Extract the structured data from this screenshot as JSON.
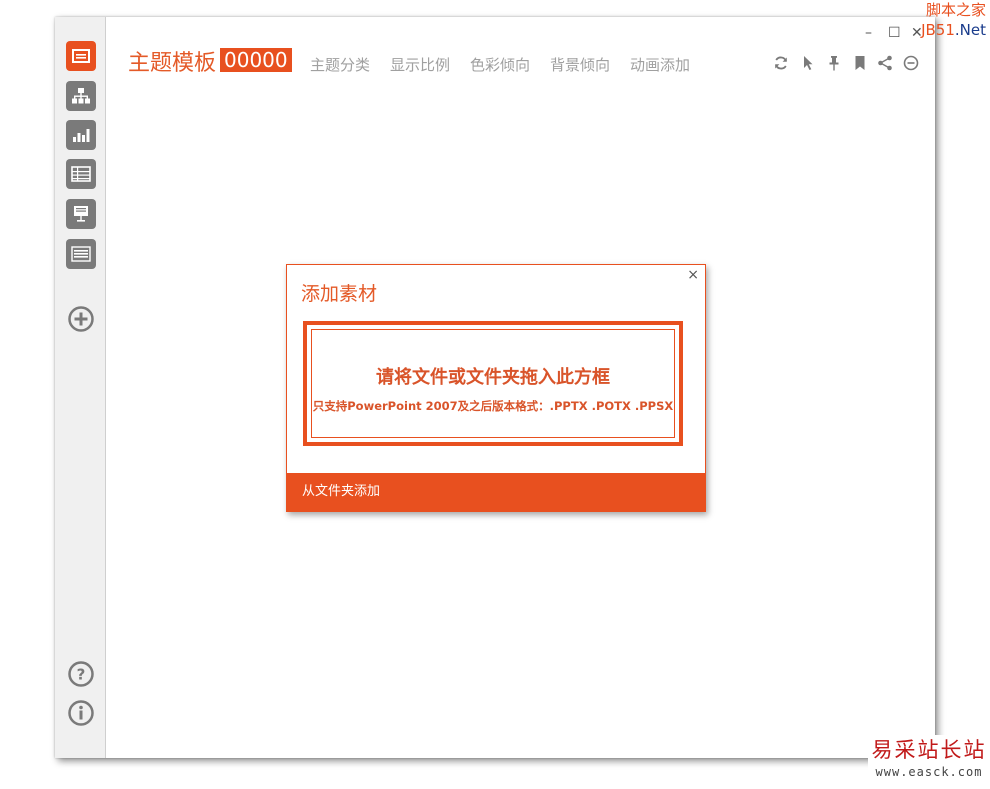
{
  "window": {
    "title": "主题模板",
    "code": "00000",
    "controls": {
      "minimize": "–",
      "maximize": "☐",
      "close": "✕"
    }
  },
  "menu": [
    {
      "label": "主题分类"
    },
    {
      "label": "显示比例"
    },
    {
      "label": "色彩倾向"
    },
    {
      "label": "背景倾向"
    },
    {
      "label": "动画添加"
    }
  ],
  "toolbar_icons": [
    "refresh-icon",
    "cursor-icon",
    "pin-icon",
    "bookmark-icon",
    "share-icon",
    "minus-circle-icon"
  ],
  "sidebar_icons": [
    "template-icon",
    "org-chart-icon",
    "bar-chart-icon",
    "table-icon",
    "presentation-icon",
    "keyboard-icon",
    "add-circle-icon",
    "help-icon",
    "info-icon"
  ],
  "dialog": {
    "title": "添加素材",
    "close": "×",
    "drop_main": "请将文件或文件夹拖入此方框",
    "drop_sub": "只支持PowerPoint 2007及之后版本格式：.PPTX .POTX .PPSX",
    "footer_button": "从文件夹添加"
  },
  "watermarks": {
    "top_cn": "脚本之家",
    "top_en_a": "JB51",
    "top_en_b": ".Net",
    "bottom_cn": "易采站长站",
    "bottom_url": "www.easck.com"
  },
  "colors": {
    "accent": "#e8501f",
    "icon_gray": "#7a7a7a",
    "menu_gray": "#a0a0a0"
  }
}
